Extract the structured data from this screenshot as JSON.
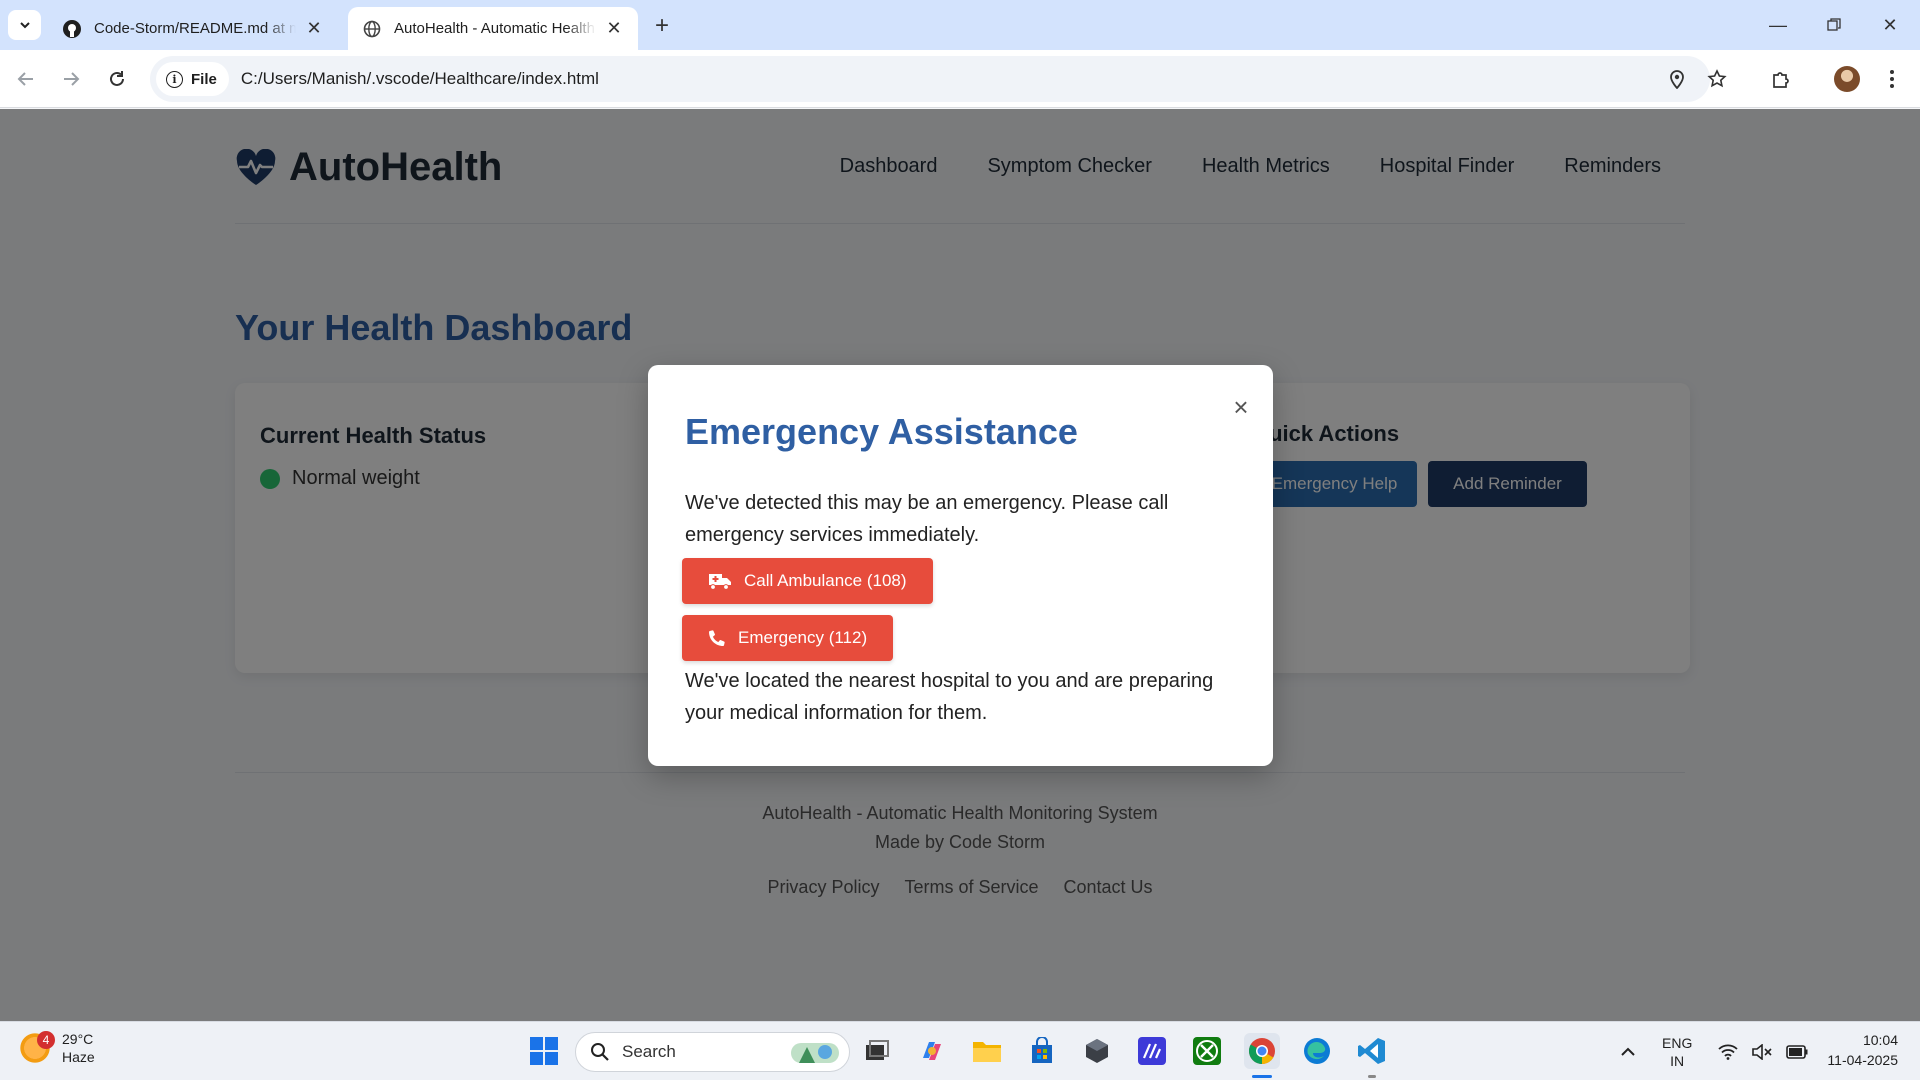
{
  "browser": {
    "tabs": [
      {
        "title": "Code-Storm/README.md at main",
        "active": false
      },
      {
        "title": "AutoHealth - Automatic Health",
        "active": true
      }
    ],
    "address": {
      "scheme_label": "File",
      "url": "C:/Users/Manish/.vscode/Healthcare/index.html"
    }
  },
  "site": {
    "brand": "AutoHealth",
    "nav": [
      "Dashboard",
      "Symptom Checker",
      "Health Metrics",
      "Hospital Finder",
      "Reminders"
    ],
    "dashboard_title": "Your Health Dashboard",
    "status_card": {
      "title": "Current Health Status",
      "status": "Normal weight",
      "status_color": "#2ecc71"
    },
    "quick_actions": {
      "title": "Quick Actions",
      "emergency_label": "Emergency Help",
      "reminder_label": "Add Reminder"
    },
    "footer": {
      "line1": "AutoHealth - Automatic Health Monitoring System",
      "line2": "Made by Code Storm",
      "links": [
        "Privacy Policy",
        "Terms of Service",
        "Contact Us"
      ]
    }
  },
  "modal": {
    "title": "Emergency Assistance",
    "close": "×",
    "message": "We've detected this may be an emergency. Please call emergency services immediately.",
    "ambulance_label": "Call Ambulance (108)",
    "emergency_label": "Emergency (112)",
    "footer_text": "We've located the nearest hospital to you and are preparing your medical information for them."
  },
  "taskbar": {
    "weather": {
      "badge": "4",
      "temp": "29°C",
      "condition": "Haze"
    },
    "search_placeholder": "Search",
    "lang": {
      "l1": "ENG",
      "l2": "IN"
    },
    "time": "10:04",
    "date": "11-04-2025"
  },
  "colors": {
    "accent": "#2f5fa3",
    "danger": "#e74c3c",
    "navy": "#1e3a66"
  }
}
